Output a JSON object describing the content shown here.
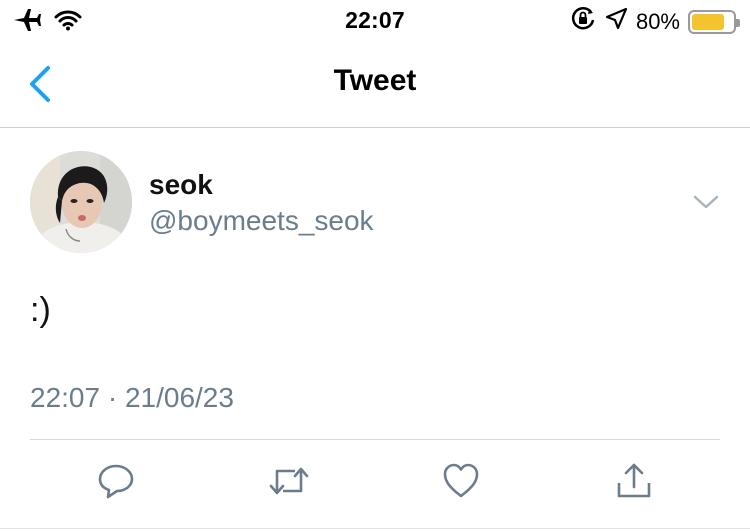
{
  "status_bar": {
    "time": "22:07",
    "battery_percent": "80%",
    "battery_level": 0.8,
    "icons": [
      "airplane-icon",
      "wifi-icon",
      "orientation-lock-icon",
      "location-arrow-icon",
      "battery-icon"
    ]
  },
  "nav": {
    "title": "Tweet",
    "back_icon": "chevron-left-icon"
  },
  "tweet": {
    "author_name": "seok",
    "author_handle": "@boymeets_seok",
    "text": ":)",
    "timestamp": "22:07 · 21/06/23",
    "menu_icon": "chevron-down-icon"
  },
  "actions": [
    "reply-icon",
    "retweet-icon",
    "like-icon",
    "share-icon"
  ],
  "colors": {
    "accent": "#1da1f2",
    "secondary_text": "#6b7d8c",
    "icon_gray": "#6b7d8c",
    "battery": "#f4c430"
  }
}
